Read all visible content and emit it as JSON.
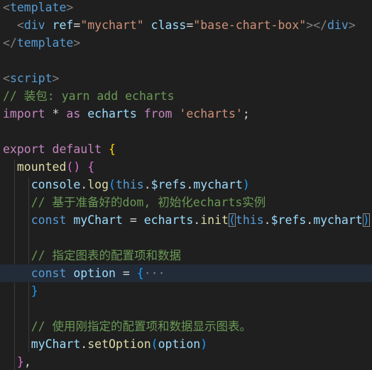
{
  "code_lines": [
    [
      {
        "t": "<",
        "c": "t-punc"
      },
      {
        "t": "template",
        "c": "t-tag"
      },
      {
        "t": ">",
        "c": "t-punc"
      }
    ],
    [
      {
        "t": "  ",
        "c": "t-plain"
      },
      {
        "t": "<",
        "c": "t-punc"
      },
      {
        "t": "div",
        "c": "t-tag"
      },
      {
        "t": " ",
        "c": "t-plain"
      },
      {
        "t": "ref",
        "c": "t-attr"
      },
      {
        "t": "=",
        "c": "t-plain"
      },
      {
        "t": "\"mychart\"",
        "c": "t-str"
      },
      {
        "t": " ",
        "c": "t-plain"
      },
      {
        "t": "class",
        "c": "t-attr"
      },
      {
        "t": "=",
        "c": "t-plain"
      },
      {
        "t": "\"base-chart-box\"",
        "c": "t-str"
      },
      {
        "t": "></",
        "c": "t-punc"
      },
      {
        "t": "div",
        "c": "t-tag"
      },
      {
        "t": ">",
        "c": "t-punc"
      }
    ],
    [
      {
        "t": "</",
        "c": "t-punc"
      },
      {
        "t": "template",
        "c": "t-tag"
      },
      {
        "t": ">",
        "c": "t-punc"
      }
    ],
    [],
    [
      {
        "t": "<",
        "c": "t-punc"
      },
      {
        "t": "script",
        "c": "t-tag"
      },
      {
        "t": ">",
        "c": "t-punc"
      }
    ],
    [
      {
        "t": "// 装包: yarn add echarts",
        "c": "t-comment"
      }
    ],
    [
      {
        "t": "import",
        "c": "t-kw"
      },
      {
        "t": " ",
        "c": "t-plain"
      },
      {
        "t": "*",
        "c": "t-plain"
      },
      {
        "t": " ",
        "c": "t-plain"
      },
      {
        "t": "as",
        "c": "t-kw"
      },
      {
        "t": " ",
        "c": "t-plain"
      },
      {
        "t": "echarts",
        "c": "t-var"
      },
      {
        "t": " ",
        "c": "t-plain"
      },
      {
        "t": "from",
        "c": "t-kw"
      },
      {
        "t": " ",
        "c": "t-plain"
      },
      {
        "t": "'echarts'",
        "c": "t-str"
      },
      {
        "t": ";",
        "c": "t-plain"
      }
    ],
    [],
    [
      {
        "t": "export",
        "c": "t-kw"
      },
      {
        "t": " ",
        "c": "t-plain"
      },
      {
        "t": "default",
        "c": "t-kw"
      },
      {
        "t": " ",
        "c": "t-plain"
      },
      {
        "t": "{",
        "c": "t-brace"
      }
    ],
    [
      {
        "t": "  ",
        "c": "t-plain"
      },
      {
        "t": "mounted",
        "c": "t-func"
      },
      {
        "t": "()",
        "c": "t-brace2"
      },
      {
        "t": " ",
        "c": "t-plain"
      },
      {
        "t": "{",
        "c": "t-brace2"
      }
    ],
    [
      {
        "t": "    ",
        "c": "t-plain"
      },
      {
        "t": "console",
        "c": "t-var"
      },
      {
        "t": ".",
        "c": "t-plain"
      },
      {
        "t": "log",
        "c": "t-func"
      },
      {
        "t": "(",
        "c": "t-brace3"
      },
      {
        "t": "this",
        "c": "t-this"
      },
      {
        "t": ".",
        "c": "t-plain"
      },
      {
        "t": "$refs",
        "c": "t-var"
      },
      {
        "t": ".",
        "c": "t-plain"
      },
      {
        "t": "mychart",
        "c": "t-var"
      },
      {
        "t": ")",
        "c": "t-brace3"
      }
    ],
    [
      {
        "t": "    ",
        "c": "t-plain"
      },
      {
        "t": "// 基于准备好的dom, 初始化echarts实例",
        "c": "t-comment"
      }
    ],
    [
      {
        "t": "    ",
        "c": "t-plain"
      },
      {
        "t": "const",
        "c": "t-this"
      },
      {
        "t": " ",
        "c": "t-plain"
      },
      {
        "t": "myChart",
        "c": "t-var"
      },
      {
        "t": " ",
        "c": "t-plain"
      },
      {
        "t": "=",
        "c": "t-plain"
      },
      {
        "t": " ",
        "c": "t-plain"
      },
      {
        "t": "echarts",
        "c": "t-var"
      },
      {
        "t": ".",
        "c": "t-plain"
      },
      {
        "t": "init",
        "c": "t-func"
      },
      {
        "t": "(",
        "c": "t-brace3",
        "box": true
      },
      {
        "t": "this",
        "c": "t-this"
      },
      {
        "t": ".",
        "c": "t-plain"
      },
      {
        "t": "$refs",
        "c": "t-var"
      },
      {
        "t": ".",
        "c": "t-plain"
      },
      {
        "t": "mychart",
        "c": "t-var"
      },
      {
        "t": ")",
        "c": "t-brace3",
        "box": true
      }
    ],
    [],
    [
      {
        "t": "    ",
        "c": "t-plain"
      },
      {
        "t": "// 指定图表的配置项和数据",
        "c": "t-comment"
      }
    ],
    [
      {
        "t": "    ",
        "c": "t-plain"
      },
      {
        "t": "const",
        "c": "t-this"
      },
      {
        "t": " ",
        "c": "t-plain"
      },
      {
        "t": "option",
        "c": "t-var"
      },
      {
        "t": " ",
        "c": "t-plain"
      },
      {
        "t": "=",
        "c": "t-plain"
      },
      {
        "t": " ",
        "c": "t-plain"
      },
      {
        "t": "{",
        "c": "t-brace3"
      },
      {
        "t": "···",
        "c": "t-fold"
      }
    ],
    [
      {
        "t": "    ",
        "c": "t-plain"
      },
      {
        "t": "}",
        "c": "t-brace3"
      }
    ],
    [],
    [
      {
        "t": "    ",
        "c": "t-plain"
      },
      {
        "t": "// 使用刚指定的配置项和数据显示图表。",
        "c": "t-comment"
      }
    ],
    [
      {
        "t": "    ",
        "c": "t-plain"
      },
      {
        "t": "myChart",
        "c": "t-var"
      },
      {
        "t": ".",
        "c": "t-plain"
      },
      {
        "t": "setOption",
        "c": "t-func"
      },
      {
        "t": "(",
        "c": "t-brace3"
      },
      {
        "t": "option",
        "c": "t-var"
      },
      {
        "t": ")",
        "c": "t-brace3"
      }
    ],
    [
      {
        "t": "  ",
        "c": "t-plain"
      },
      {
        "t": "}",
        "c": "t-brace2"
      },
      {
        "t": ",",
        "c": "t-plain"
      }
    ]
  ],
  "current_line_index": 15,
  "colors": {
    "background": "#1f1f1f",
    "current_line": "#222b38",
    "comment": "#6a9955",
    "string": "#ce9178",
    "keyword": "#c586c0",
    "tag": "#569cd6",
    "variable": "#9cdcfe",
    "function": "#dcdcaa"
  }
}
